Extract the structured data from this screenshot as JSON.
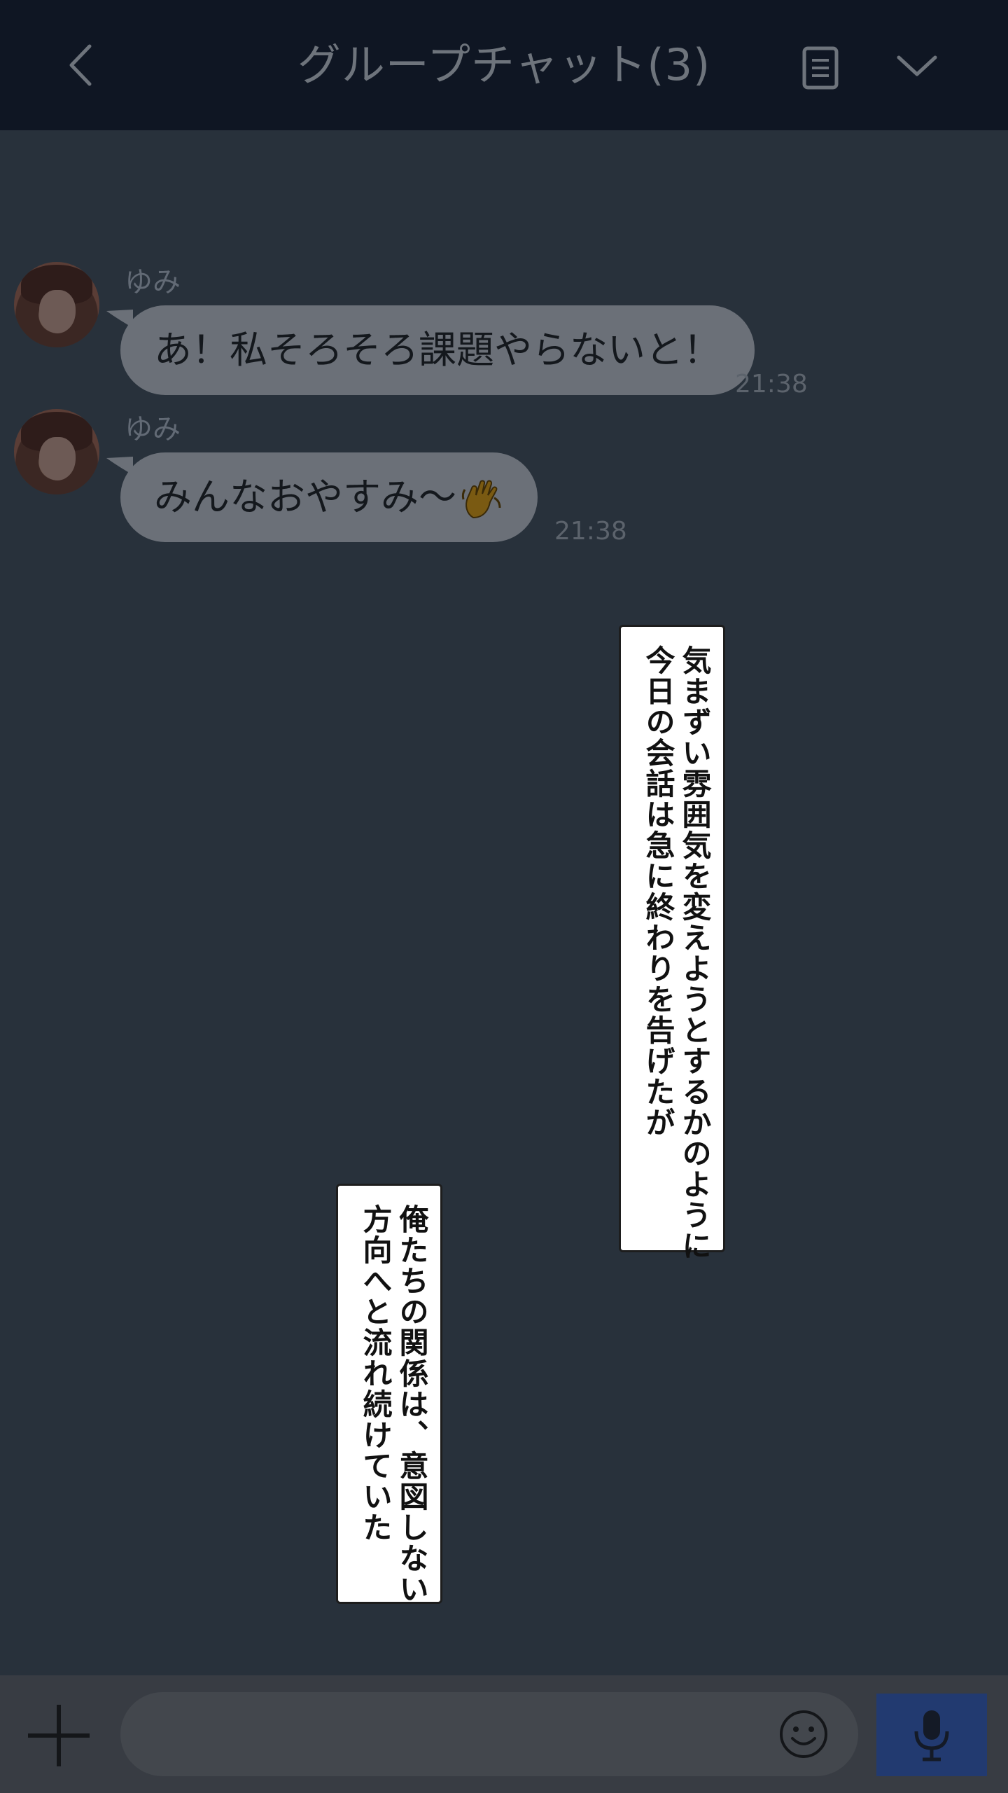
{
  "header": {
    "title": "グループチャット(3)",
    "back_icon": "chevron-left-icon",
    "notes_icon": "notes-icon",
    "menu_icon": "chevron-down-icon",
    "background": "#0f1623"
  },
  "messages": [
    {
      "sender": "ゆみ",
      "text": "あ！私そろそろ課題やらないと！",
      "time": "21:38"
    },
    {
      "sender": "ゆみ",
      "text": "みんなおやすみ～",
      "emoji": "waving-hand-icon",
      "time": "21:38"
    }
  ],
  "narration": [
    {
      "lines": [
        "気まずい雰囲気を変えようとするかのように",
        "今日の会話は急に終わりを告げたが"
      ]
    },
    {
      "lines": [
        "俺たちの関係は、意図しない",
        "方向へと流れ続けていた"
      ]
    }
  ],
  "footer": {
    "plus_icon": "plus-icon",
    "input_value": "",
    "emoji_icon": "smiley-icon",
    "mic_icon": "microphone-icon",
    "mic_color": "#223a70"
  },
  "colors": {
    "chat_background": "#28313b",
    "bubble": "#6b7078"
  }
}
